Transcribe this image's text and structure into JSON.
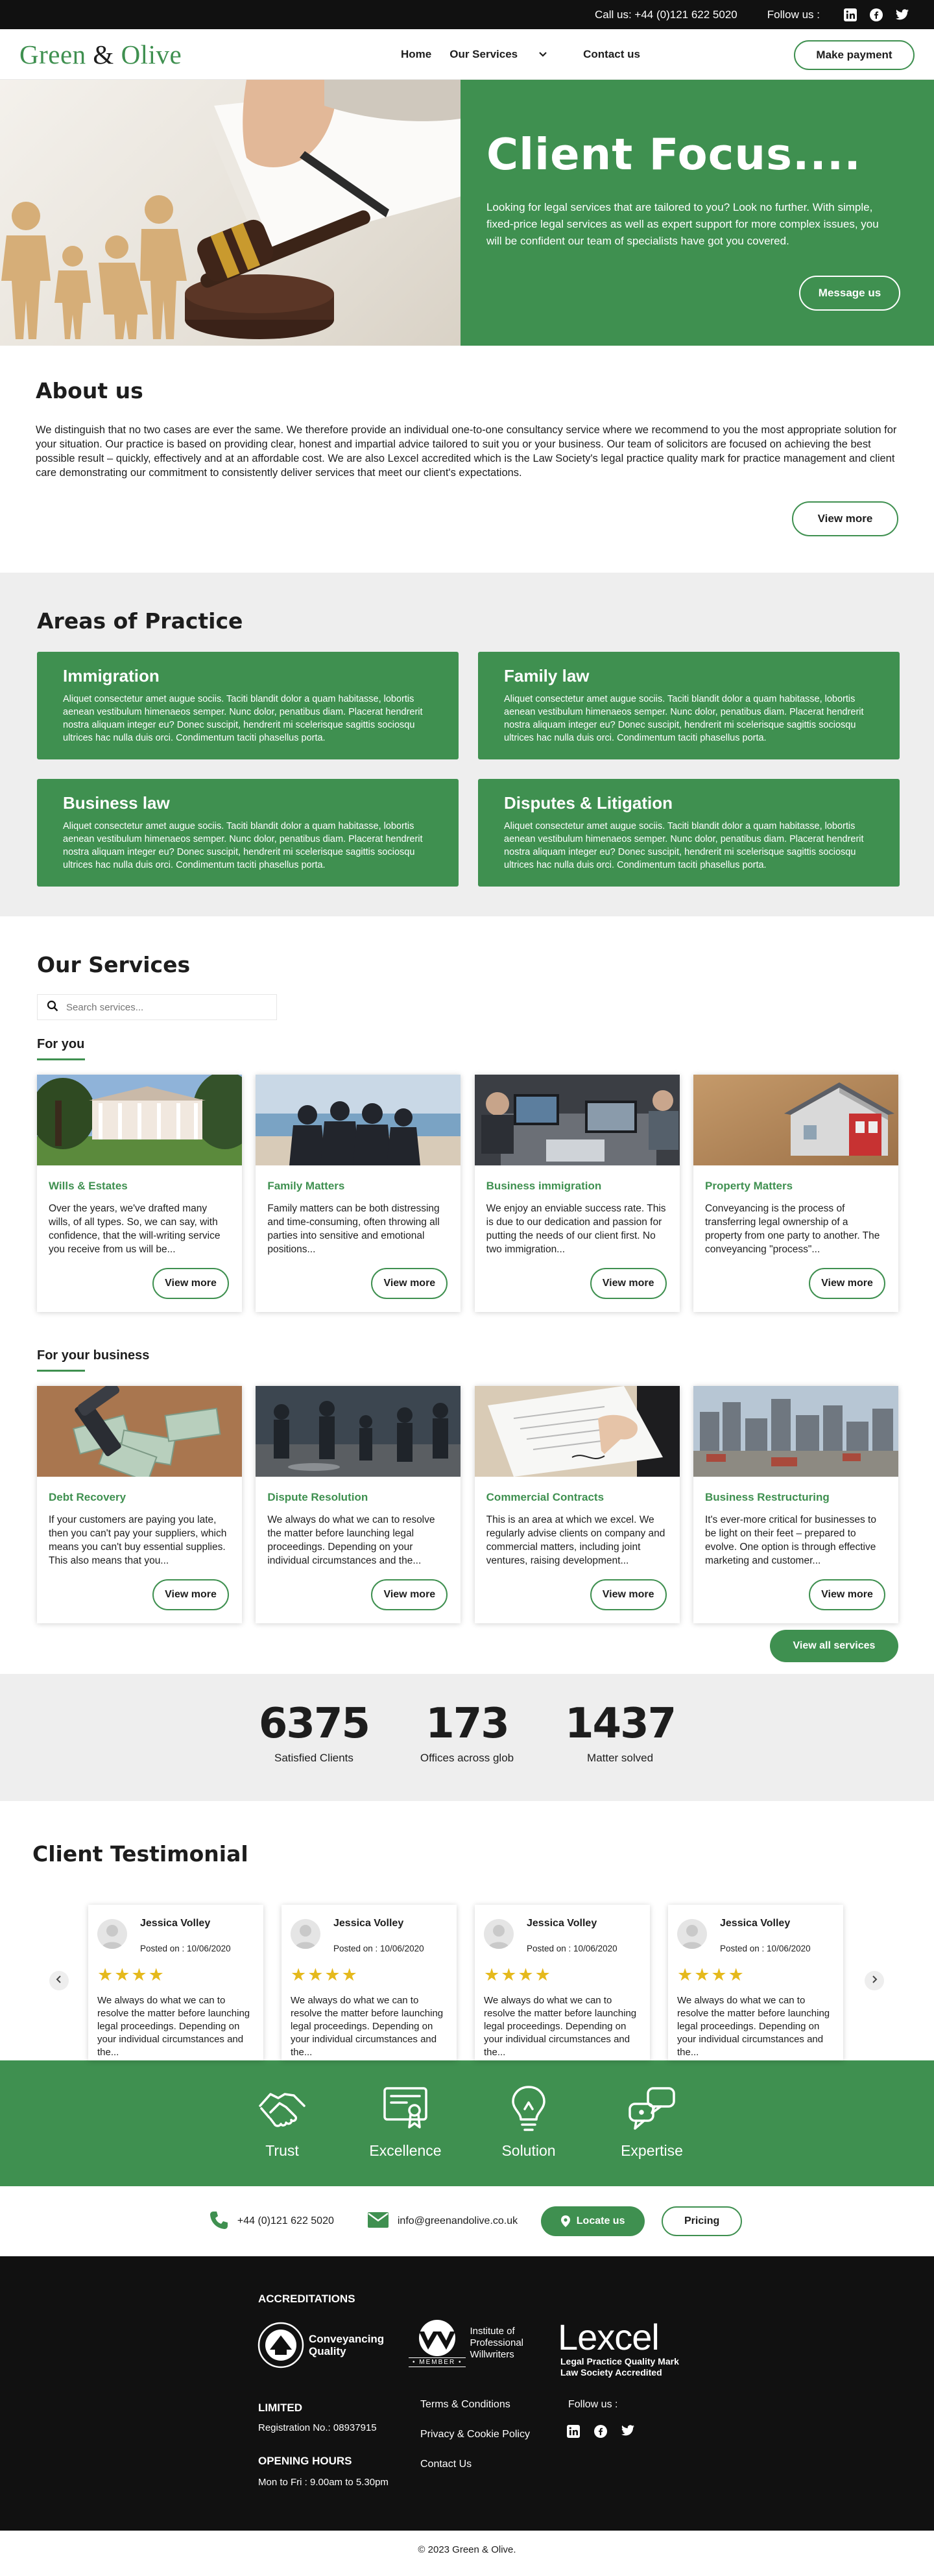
{
  "topbar": {
    "call": "Call us: +44 (0)121 622 5020",
    "follow": "Follow us :"
  },
  "header": {
    "logo_left": "Green ",
    "logo_amp": "&",
    "logo_right": " Olive",
    "nav": {
      "home": "Home",
      "services": "Our Services",
      "contact": "Contact us"
    },
    "pay_button": "Make payment"
  },
  "hero": {
    "title": "Client Focus....",
    "text": "Looking for legal services that are tailored to you? Look no further. With simple, fixed-price legal services as well as expert support for more complex issues, you will be confident our team of specialists have got you covered.",
    "button": "Message us"
  },
  "about": {
    "title": "About us",
    "text": "We distinguish that no two cases are ever the same. We therefore provide an individual one-to-one consultancy service where we recommend to you the most appropriate solution for your situation. Our practice is based on providing clear, honest and impartial advice tailored to suit you or your business. Our team of solicitors are focused on achieving the best possible result – quickly, effectively and at an affordable cost. We are also Lexcel accredited which is the Law Society's legal practice quality mark for practice management and client care demonstrating our commitment to consistently deliver services that meet our client's expectations.",
    "button": "View more"
  },
  "areas": {
    "title": "Areas of Practice",
    "items": [
      {
        "title": "Immigration",
        "text": "Aliquet consectetur amet augue sociis. Taciti blandit dolor a quam habitasse, lobortis aenean vestibulum himenaeos semper. Nunc dolor, penatibus diam. Placerat hendrerit nostra aliquam integer eu? Donec suscipit, hendrerit mi scelerisque sagittis sociosqu ultrices hac nulla duis orci. Condimentum taciti phasellus porta."
      },
      {
        "title": "Family law",
        "text": "Aliquet consectetur amet augue sociis. Taciti blandit dolor a quam habitasse, lobortis aenean vestibulum himenaeos semper. Nunc dolor, penatibus diam. Placerat hendrerit nostra aliquam integer eu? Donec suscipit, hendrerit mi scelerisque sagittis sociosqu ultrices hac nulla duis orci. Condimentum taciti phasellus porta."
      },
      {
        "title": "Business law",
        "text": "Aliquet consectetur amet augue sociis. Taciti blandit dolor a quam habitasse, lobortis aenean vestibulum himenaeos semper. Nunc dolor, penatibus diam. Placerat hendrerit nostra aliquam integer eu? Donec suscipit, hendrerit mi scelerisque sagittis sociosqu ultrices hac nulla duis orci. Condimentum taciti phasellus porta."
      },
      {
        "title": "Disputes & Litigation",
        "text": "Aliquet consectetur amet augue sociis. Taciti blandit dolor a quam habitasse, lobortis aenean vestibulum himenaeos semper. Nunc dolor, penatibus diam. Placerat hendrerit nostra aliquam integer eu? Donec suscipit, hendrerit mi scelerisque sagittis sociosqu ultrices hac nulla duis orci. Condimentum taciti phasellus porta."
      }
    ]
  },
  "services": {
    "title": "Our Services",
    "search_placeholder": "Search services...",
    "group1": "For you",
    "group2": "For your business",
    "view_more": "View more",
    "all_button": "View all services",
    "personal": [
      {
        "title": "Wills & Estates",
        "text": "Over the years, we've drafted many wills, of all types. So, we can say, with confidence, that the will-writing service you receive from us will be..."
      },
      {
        "title": "Family Matters",
        "text": "Family matters can be both distressing and time-consuming, often throwing all parties into sensitive and emotional positions..."
      },
      {
        "title": "Business immigration",
        "text": "We enjoy an enviable success rate. This is due to our dedication and passion for putting the needs of our client first. No two immigration..."
      },
      {
        "title": "Property Matters",
        "text": "Conveyancing is the process of transferring legal ownership of a property from one party to another. The conveyancing \"process\"..."
      }
    ],
    "business": [
      {
        "title": "Debt Recovery",
        "text": "If your customers are paying you late, then you can't pay your suppliers, which means you can't buy essential supplies. This also means that you..."
      },
      {
        "title": "Dispute Resolution",
        "text": "We always do what we can to resolve the matter before launching legal proceedings. Depending on your individual circumstances and the..."
      },
      {
        "title": "Commercial Contracts",
        "text": "This is an area at which we excel. We regularly advise clients on company and commercial matters, including joint ventures, raising development..."
      },
      {
        "title": "Business Restructuring",
        "text": "It's ever-more critical for businesses to be light on their feet – prepared to evolve. One option is through effective marketing and customer..."
      }
    ]
  },
  "stats": [
    {
      "num": "6375",
      "label": "Satisfied Clients"
    },
    {
      "num": "173",
      "label": "Offices across glob"
    },
    {
      "num": "1437",
      "label": "Matter solved"
    }
  ],
  "testimonial": {
    "title": "Client Testimonial",
    "items": [
      {
        "name": "Jessica Volley",
        "date": "Posted on : 10/06/2020",
        "stars": "★★★★",
        "text": "We always do what we can to resolve the matter before launching legal proceedings. Depending on your individual circumstances and the..."
      },
      {
        "name": "Jessica Volley",
        "date": "Posted on : 10/06/2020",
        "stars": "★★★★",
        "text": "We always do what we can to resolve the matter before launching legal proceedings. Depending on your individual circumstances and the..."
      },
      {
        "name": "Jessica Volley",
        "date": "Posted on : 10/06/2020",
        "stars": "★★★★",
        "text": "We always do what we can to resolve the matter before launching legal proceedings. Depending on your individual circumstances and the..."
      },
      {
        "name": "Jessica Volley",
        "date": "Posted on : 10/06/2020",
        "stars": "★★★★",
        "text": "We always do what we can to resolve the matter before launching legal proceedings. Depending on your individual circumstances and the..."
      }
    ]
  },
  "features": [
    {
      "label": "Trust",
      "icon": "handshake-icon"
    },
    {
      "label": "Excellence",
      "icon": "certificate-icon"
    },
    {
      "label": "Solution",
      "icon": "lightbulb-icon"
    },
    {
      "label": "Expertise",
      "icon": "chat-icon"
    }
  ],
  "contact": {
    "phone": "+44 (0)121 622 5020",
    "email": "info@greenandolive.co.uk",
    "locate": "Locate us",
    "pricing": "Pricing"
  },
  "footer": {
    "accreditations": "ACCREDITATIONS",
    "cq_line1": "Conveyancing",
    "cq_line2": "Quality",
    "ipw_line1": "Institute of",
    "ipw_line2": "Professional",
    "ipw_line3": "Willwriters",
    "ipw_member": "• MEMBER •",
    "lexcel": "Lexcel",
    "lexcel_sub1": "Legal Practice Quality Mark",
    "lexcel_sub2": "Law Society Accredited",
    "limited": "LIMITED",
    "registration": "Registration No.: 08937915",
    "opening": "OPENING HOURS",
    "hours": "Mon to Fri : 9.00am to 5.30pm",
    "links": [
      "Terms & Conditions",
      "Privacy & Cookie Policy",
      "Contact Us"
    ],
    "follow": "Follow us :",
    "copyright": "© 2023 Green & Olive."
  },
  "colors": {
    "brand_green": "#3f9050",
    "dark": "#111111",
    "star": "#e5b91d"
  }
}
